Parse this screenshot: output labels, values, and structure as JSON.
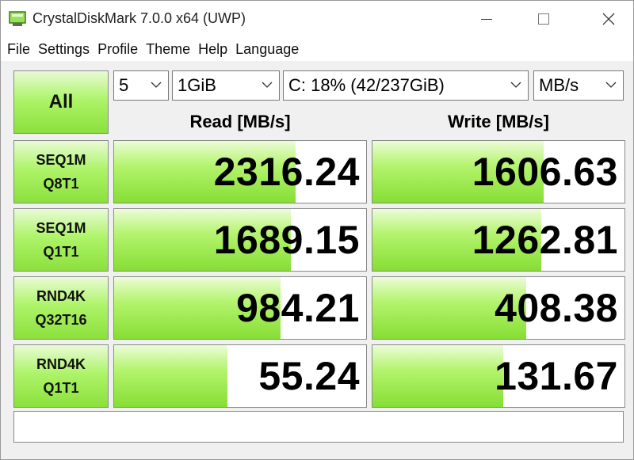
{
  "window": {
    "title": "CrystalDiskMark 7.0.0 x64 (UWP)",
    "accent_green": "#8ce03c"
  },
  "menu": [
    "File",
    "Settings",
    "Profile",
    "Theme",
    "Help",
    "Language"
  ],
  "controls": {
    "all_label": "All",
    "test_count": "5",
    "test_size": "1GiB",
    "drive": "C: 18% (42/237GiB)",
    "unit": "MB/s"
  },
  "headers": {
    "read": "Read [MB/s]",
    "write": "Write [MB/s]"
  },
  "tests": [
    {
      "line1": "SEQ1M",
      "line2": "Q8T1",
      "read": "2316.24",
      "write": "1606.63",
      "read_fill": 0.72,
      "write_fill": 0.68
    },
    {
      "line1": "SEQ1M",
      "line2": "Q1T1",
      "read": "1689.15",
      "write": "1262.81",
      "read_fill": 0.7,
      "write_fill": 0.67
    },
    {
      "line1": "RND4K",
      "line2": "Q32T16",
      "read": "984.21",
      "write": "408.38",
      "read_fill": 0.66,
      "write_fill": 0.61
    },
    {
      "line1": "RND4K",
      "line2": "Q1T1",
      "read": "55.24",
      "write": "131.67",
      "read_fill": 0.45,
      "write_fill": 0.52
    }
  ],
  "comment": ""
}
